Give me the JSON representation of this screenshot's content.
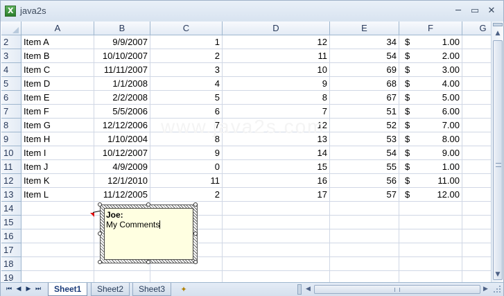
{
  "window": {
    "title": "java2s",
    "app_icon": "excel-icon",
    "controls": {
      "minimize": "─",
      "restore": "▭",
      "close": "✕"
    }
  },
  "columns": [
    "A",
    "B",
    "C",
    "D",
    "E",
    "F",
    "G"
  ],
  "rows": [
    {
      "num": "2",
      "a": "Item A",
      "b": "9/9/2007",
      "c": "1",
      "d": "12",
      "e": "34",
      "f_sym": "$",
      "f": "1.00"
    },
    {
      "num": "3",
      "a": "Item B",
      "b": "10/10/2007",
      "c": "2",
      "d": "11",
      "e": "54",
      "f_sym": "$",
      "f": "2.00"
    },
    {
      "num": "4",
      "a": "Item C",
      "b": "11/11/2007",
      "c": "3",
      "d": "10",
      "e": "69",
      "f_sym": "$",
      "f": "3.00"
    },
    {
      "num": "5",
      "a": "Item D",
      "b": "1/1/2008",
      "c": "4",
      "d": "9",
      "e": "68",
      "f_sym": "$",
      "f": "4.00"
    },
    {
      "num": "6",
      "a": "Item E",
      "b": "2/2/2008",
      "c": "5",
      "d": "8",
      "e": "67",
      "f_sym": "$",
      "f": "5.00"
    },
    {
      "num": "7",
      "a": "Item F",
      "b": "5/5/2006",
      "c": "6",
      "d": "7",
      "e": "51",
      "f_sym": "$",
      "f": "6.00"
    },
    {
      "num": "8",
      "a": "Item G",
      "b": "12/12/2006",
      "c": "7",
      "d": "12",
      "e": "52",
      "f_sym": "$",
      "f": "7.00"
    },
    {
      "num": "9",
      "a": "Item H",
      "b": "1/10/2004",
      "c": "8",
      "d": "13",
      "e": "53",
      "f_sym": "$",
      "f": "8.00"
    },
    {
      "num": "10",
      "a": "Item I",
      "b": "10/12/2007",
      "c": "9",
      "d": "14",
      "e": "54",
      "f_sym": "$",
      "f": "9.00"
    },
    {
      "num": "11",
      "a": "Item J",
      "b": "4/9/2009",
      "c": "0",
      "d": "15",
      "e": "55",
      "f_sym": "$",
      "f": "1.00"
    },
    {
      "num": "12",
      "a": "Item K",
      "b": "12/1/2010",
      "c": "11",
      "d": "16",
      "e": "56",
      "f_sym": "$",
      "f": "11.00"
    },
    {
      "num": "13",
      "a": "Item L",
      "b": "11/12/2005",
      "c": "2",
      "d": "17",
      "e": "57",
      "f_sym": "$",
      "f": "12.00"
    },
    {
      "num": "14",
      "a": "",
      "b": "",
      "c": "",
      "d": "",
      "e": "",
      "f_sym": "",
      "f": ""
    },
    {
      "num": "15",
      "a": "",
      "b": "",
      "c": "",
      "d": "",
      "e": "",
      "f_sym": "",
      "f": ""
    },
    {
      "num": "16",
      "a": "",
      "b": "",
      "c": "",
      "d": "",
      "e": "",
      "f_sym": "",
      "f": ""
    },
    {
      "num": "17",
      "a": "",
      "b": "",
      "c": "",
      "d": "",
      "e": "",
      "f_sym": "",
      "f": ""
    },
    {
      "num": "18",
      "a": "",
      "b": "",
      "c": "",
      "d": "",
      "e": "",
      "f_sym": "",
      "f": ""
    },
    {
      "num": "19",
      "a": "",
      "b": "",
      "c": "",
      "d": "",
      "e": "",
      "f_sym": "",
      "f": ""
    }
  ],
  "comment": {
    "author": "Joe:",
    "text": "My Comments"
  },
  "watermark": "www.java2s.com",
  "sheet_nav": {
    "first": "⏮",
    "prev": "◀",
    "next": "▶",
    "last": "⏭"
  },
  "sheets": [
    {
      "label": "Sheet1",
      "active": true
    },
    {
      "label": "Sheet2",
      "active": false
    },
    {
      "label": "Sheet3",
      "active": false
    }
  ],
  "insert_sheet_icon": "insert-sheet-icon",
  "scroll": {
    "up": "▲",
    "down": "▼",
    "left": "◀",
    "right": "▶"
  }
}
